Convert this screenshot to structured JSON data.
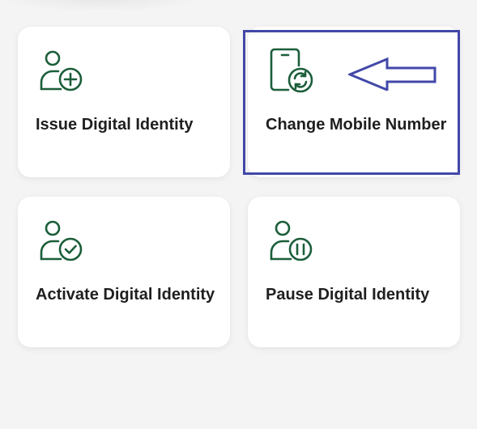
{
  "cards": [
    {
      "id": "issue",
      "label": "Issue Digital Identity",
      "icon": "user-add-icon"
    },
    {
      "id": "change",
      "label": "Change Mobile Number",
      "icon": "phone-sync-icon"
    },
    {
      "id": "activate",
      "label": "Activate Digital Identity",
      "icon": "user-check-icon"
    },
    {
      "id": "pause",
      "label": "Pause Digital Identity",
      "icon": "user-pause-icon"
    }
  ],
  "colors": {
    "icon": "#1b5e3a",
    "text": "#1f1f1f",
    "card": "#ffffff",
    "background": "#f4f4f5",
    "highlight": "#4248a8"
  }
}
